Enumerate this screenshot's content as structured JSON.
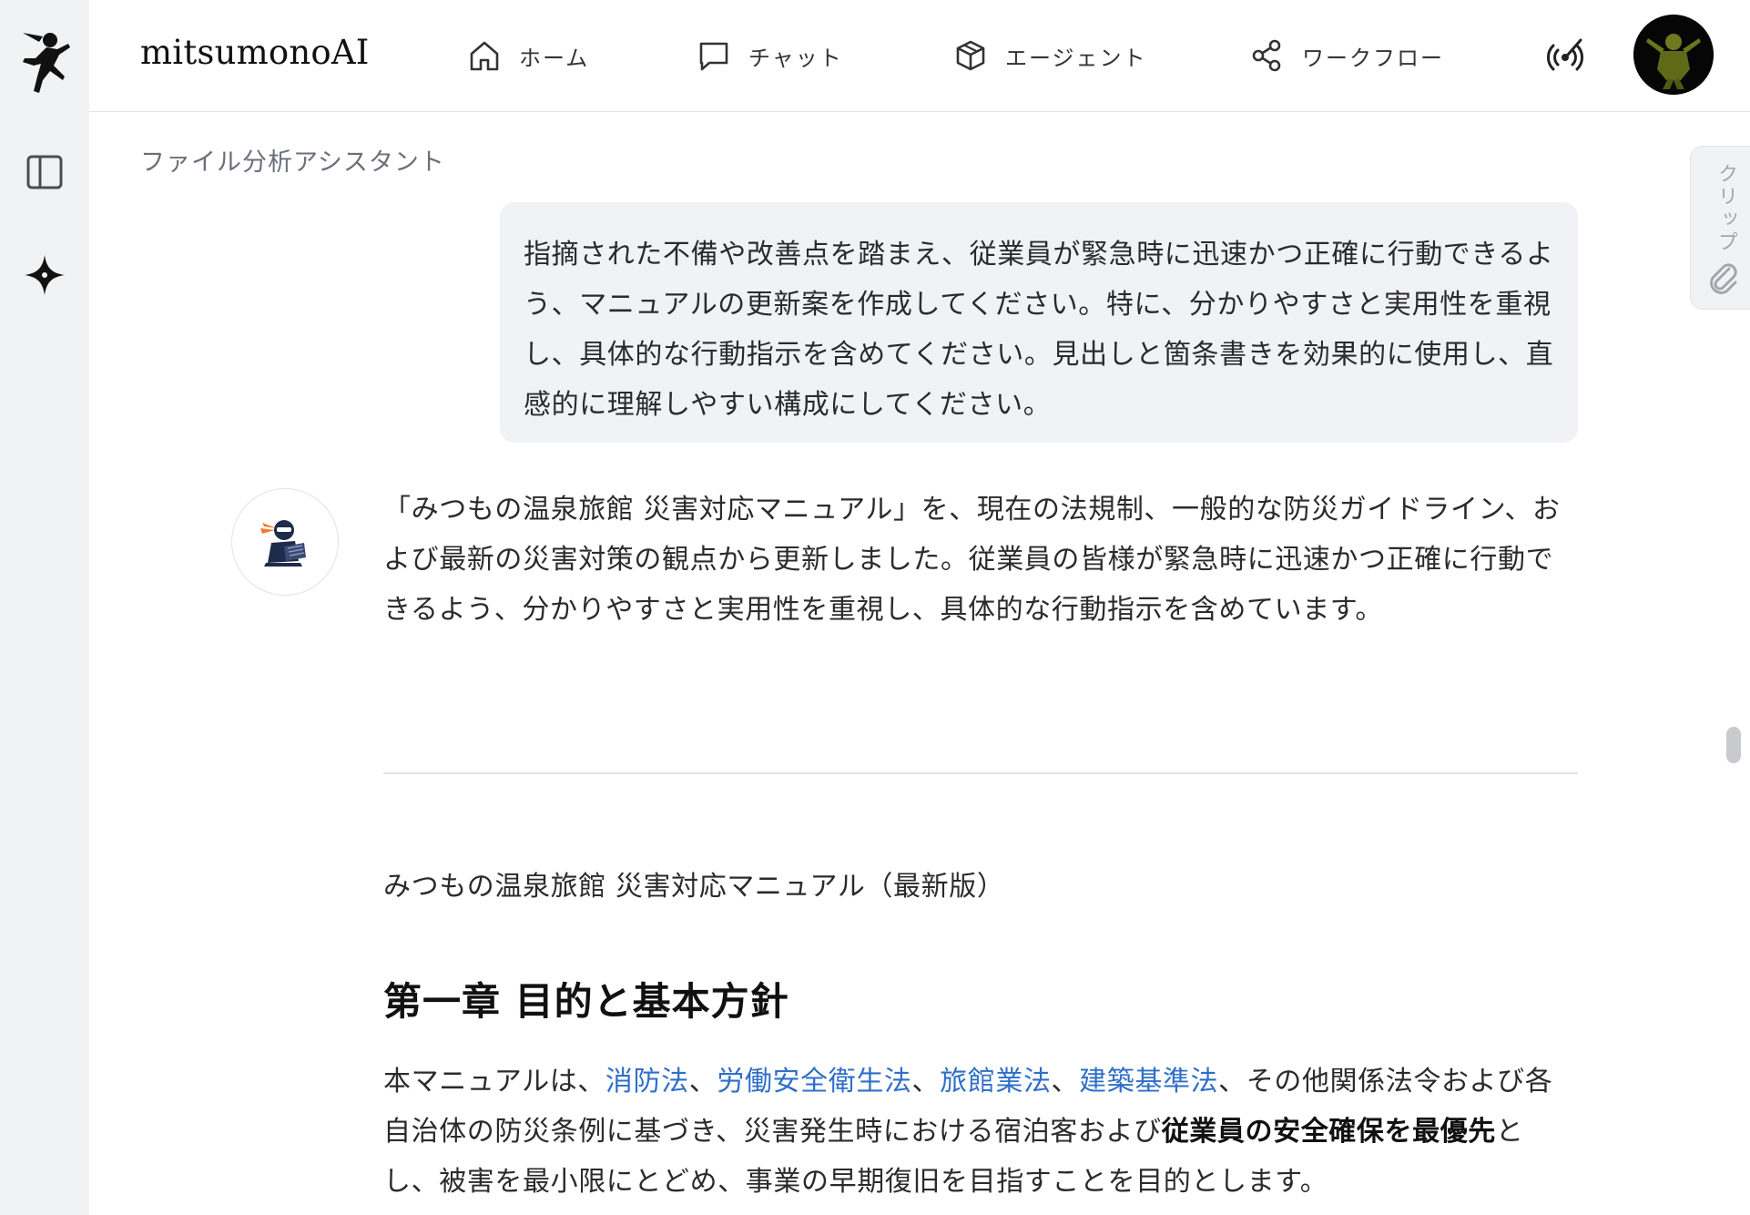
{
  "app": {
    "brand": "mitsumonoAI"
  },
  "rail": {
    "logo_icon": "ninja-runner-logo",
    "sidebar_toggle_icon": "sidebar-panel-icon",
    "new_chat_icon": "sparkle-icon"
  },
  "nav": {
    "items": [
      {
        "label": "ホーム",
        "icon": "home-icon"
      },
      {
        "label": "チャット",
        "icon": "chat-bubble-icon"
      },
      {
        "label": "エージェント",
        "icon": "cube-icon"
      },
      {
        "label": "ワークフロー",
        "icon": "share-nodes-icon"
      }
    ],
    "broadcast_icon": "broadcast-icon",
    "avatar_icon": "user-avatar"
  },
  "conversation": {
    "assistant_name": "ファイル分析アシスタント",
    "user_message": "指摘された不備や改善点を踏まえ、従業員が緊急時に迅速かつ正確に行動できるよう、マニュアルの更新案を作成してください。特に、分かりやすさと実用性を重視し、具体的な行動指示を含めてください。見出しと箇条書きを効果的に使用し、直感的に理解しやすい構成にしてください。",
    "assistant_intro": "「みつもの温泉旅館 災害対応マニュアル」を、現在の法規制、一般的な防災ガイドライン、および最新の災害対策の観点から更新しました。従業員の皆様が緊急時に迅速かつ正確に行動できるよう、分かりやすさと実用性を重視し、具体的な行動指示を含めています。",
    "doc_title": "みつもの温泉旅館 災害対応マニュアル（最新版）",
    "chapter_heading": "第一章 目的と基本方針",
    "chapter_body": {
      "t1": "本マニュアルは、",
      "link1": "消防法",
      "sep1": "、",
      "link2": "労働安全衛生法",
      "sep2": "、",
      "link3": "旅館業法",
      "sep3": "、",
      "link4": "建築基準法",
      "t2": "、その他関係法令および各自治体の防災条例に基づき、災害発生時における宿泊客および",
      "bold": "従業員の安全確保を最優先",
      "t3": "とし、被害を最小限にとどめ、事業の早期復旧を目指すことを目的とします。"
    }
  },
  "right_panel": {
    "clip_label": "クリップ",
    "clip_icon": "paperclip-icon"
  },
  "colors": {
    "rail_bg": "#f1f2f4",
    "bubble_bg": "#f0f2f5",
    "link": "#2f6fc8",
    "muted_text": "#6a6f7a"
  }
}
